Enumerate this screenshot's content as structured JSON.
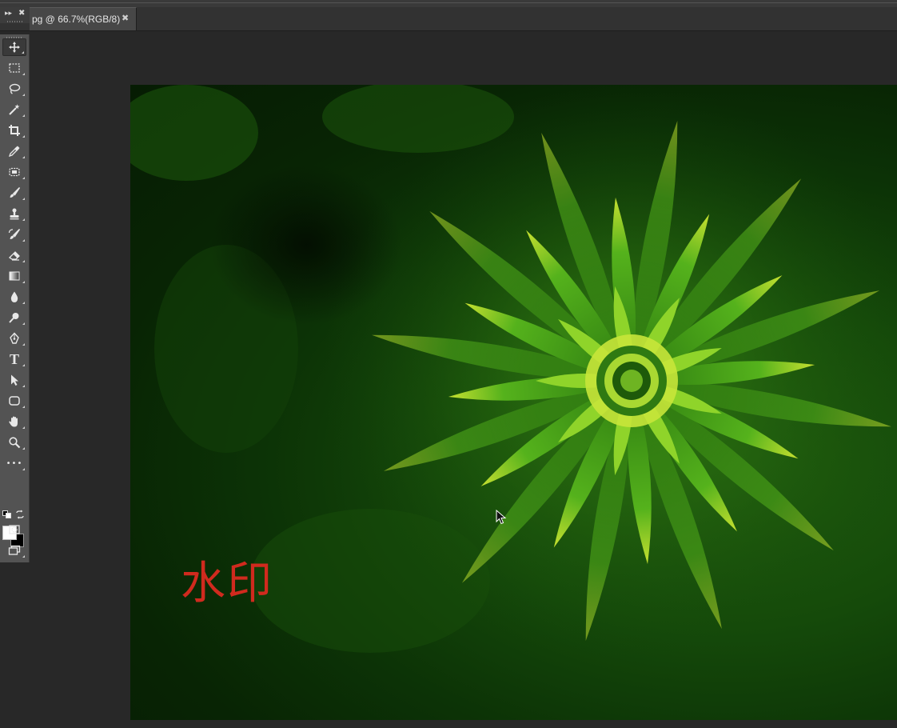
{
  "document_tab": {
    "title": "pg @ 66.7%(RGB/8)",
    "close_glyph": "✖"
  },
  "panel_header": {
    "collapse_glyph": "▸▸",
    "close_glyph": "✖"
  },
  "toolbar": {
    "tools": [
      {
        "name": "move-tool-icon"
      },
      {
        "name": "rectangular-marquee-tool-icon"
      },
      {
        "name": "lasso-tool-icon"
      },
      {
        "name": "magic-wand-tool-icon"
      },
      {
        "name": "crop-tool-icon"
      },
      {
        "name": "eyedropper-tool-icon"
      },
      {
        "name": "spot-healing-brush-tool-icon"
      },
      {
        "name": "brush-tool-icon"
      },
      {
        "name": "clone-stamp-tool-icon"
      },
      {
        "name": "history-brush-tool-icon"
      },
      {
        "name": "eraser-tool-icon"
      },
      {
        "name": "gradient-tool-icon"
      },
      {
        "name": "blur-tool-icon"
      },
      {
        "name": "dodge-tool-icon"
      },
      {
        "name": "pen-tool-icon"
      },
      {
        "name": "type-tool-icon",
        "glyph": "T"
      },
      {
        "name": "path-selection-tool-icon"
      },
      {
        "name": "rectangle-tool-icon"
      },
      {
        "name": "hand-tool-icon"
      },
      {
        "name": "zoom-tool-icon"
      },
      {
        "name": "edit-toolbar-icon",
        "glyph": "•••"
      },
      {
        "name": "quick-mask-icon"
      },
      {
        "name": "screen-mode-icon"
      }
    ],
    "foreground_color": "#ffffff",
    "background_color": "#000000"
  },
  "canvas": {
    "watermark_text": "水印",
    "watermark_color": "#d02a1e",
    "image_subject": "green fern rosette"
  },
  "colors": {
    "toolbar_bg": "#535353",
    "workspace_bg": "#282828",
    "tab_active_bg": "#474747"
  }
}
